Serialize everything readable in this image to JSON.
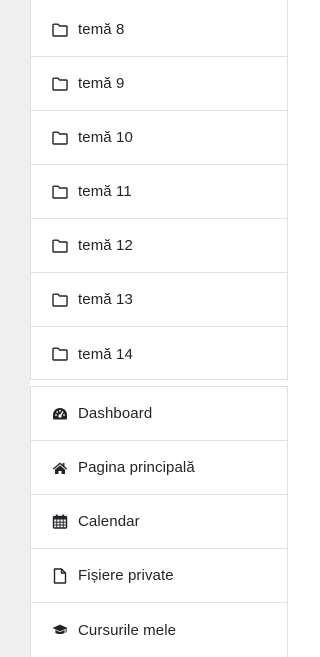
{
  "topics": [
    {
      "label": "temă 8",
      "icon": "folder-icon"
    },
    {
      "label": "temă 9",
      "icon": "folder-icon"
    },
    {
      "label": "temă 10",
      "icon": "folder-icon"
    },
    {
      "label": "temă 11",
      "icon": "folder-icon"
    },
    {
      "label": "temă 12",
      "icon": "folder-icon"
    },
    {
      "label": "temă 13",
      "icon": "folder-icon"
    },
    {
      "label": "temă 14",
      "icon": "folder-icon"
    }
  ],
  "nav": [
    {
      "label": "Dashboard",
      "icon": "dashboard-icon"
    },
    {
      "label": "Pagina principală",
      "icon": "home-icon"
    },
    {
      "label": "Calendar",
      "icon": "calendar-icon"
    },
    {
      "label": "Fișiere private",
      "icon": "file-icon"
    },
    {
      "label": "Cursurile mele",
      "icon": "graduation-cap-icon"
    }
  ],
  "colors": {
    "border": "#dee2e6",
    "text": "#212529",
    "background_strip": "#efefef"
  }
}
